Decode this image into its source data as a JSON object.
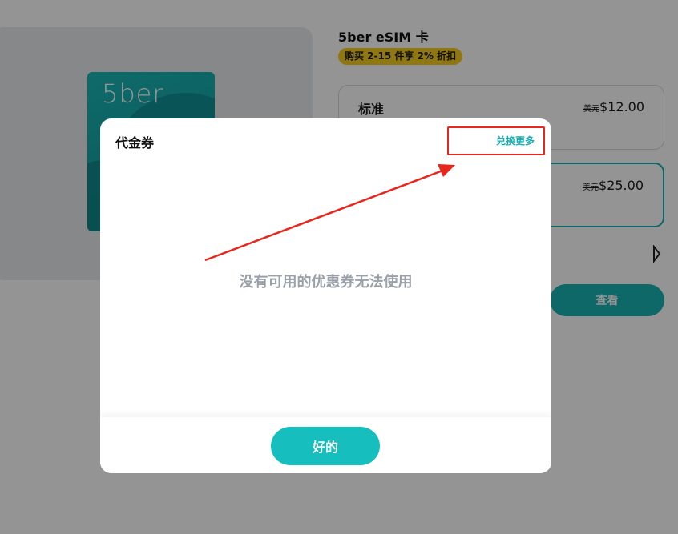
{
  "product": {
    "card_logo": "5ber",
    "title": "5ber eSIM 卡",
    "promo_badge": "购买 2-15 件享 2% 折扣"
  },
  "plans": [
    {
      "name": "标准",
      "currency": "美元",
      "price": "$12.00",
      "selected": false
    },
    {
      "name": "",
      "currency": "美元",
      "price": "$25.00",
      "selected": true
    }
  ],
  "view_button_label": "查看",
  "modal": {
    "title": "代金券",
    "redeem_link": "兑换更多",
    "empty_message": "没有可用的优惠券无法使用",
    "ok_button": "好的"
  },
  "colors": {
    "accent": "#16bebd",
    "link": "#16aeb4",
    "annotation": "#e8261c",
    "badge": "#f6cf1f"
  },
  "icons": {
    "next": "chevron-right-icon"
  }
}
